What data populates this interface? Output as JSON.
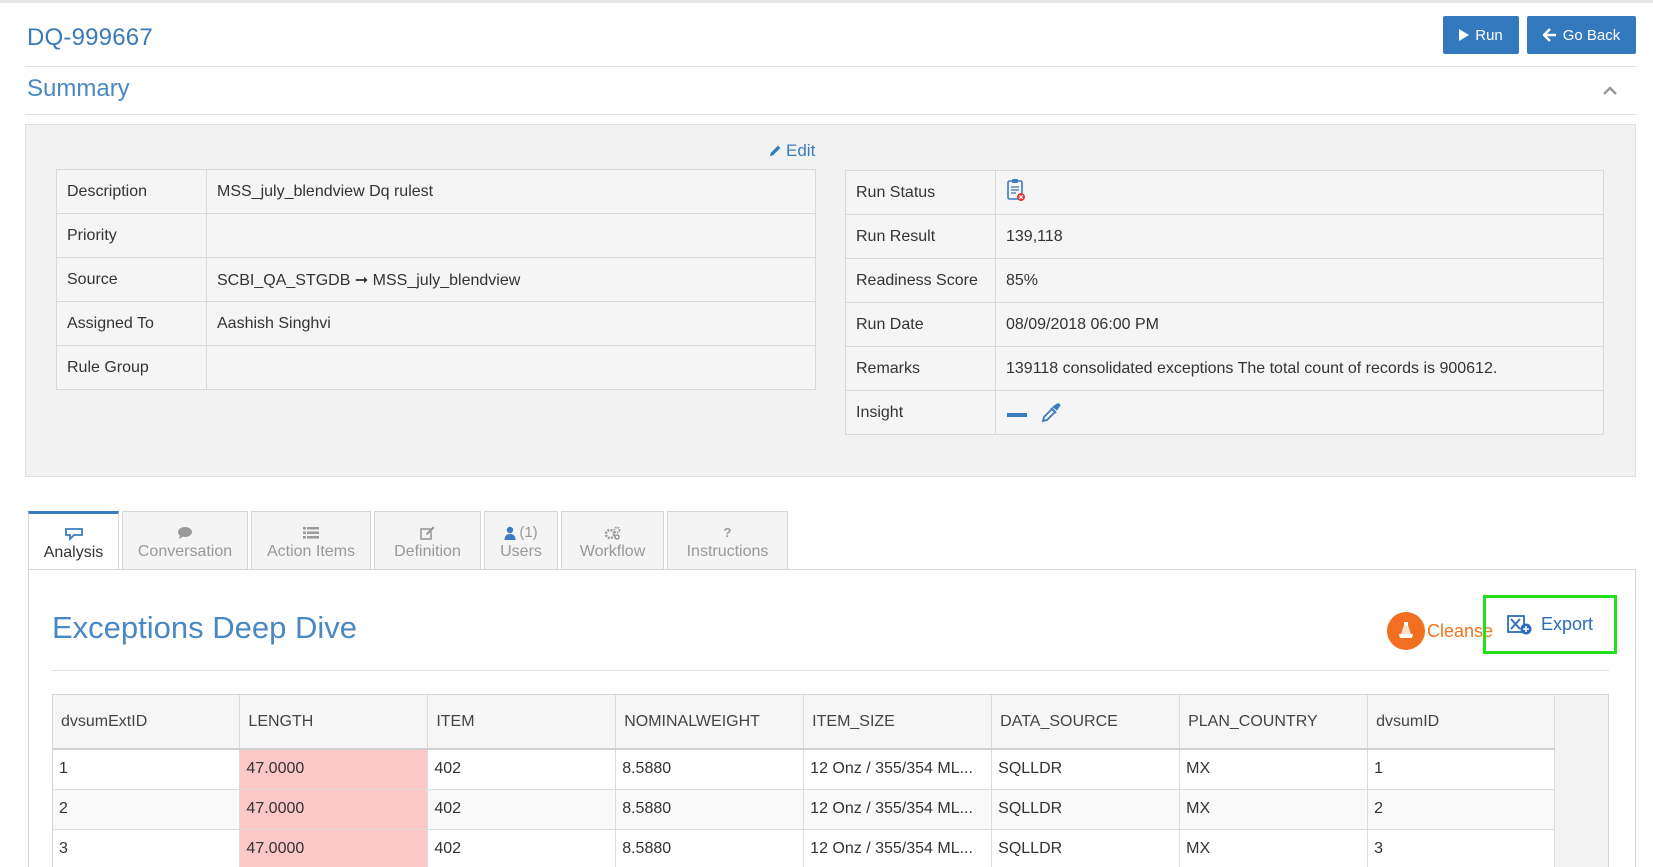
{
  "header": {
    "title": "DQ-999667",
    "run_label": "Run",
    "go_back_label": "Go Back"
  },
  "summary": {
    "title": "Summary",
    "edit_label": "Edit",
    "left_rows": [
      {
        "label": "Description",
        "value": "MSS_july_blendview Dq rulest"
      },
      {
        "label": "Priority",
        "value": ""
      },
      {
        "label": "Source",
        "value": "SCBI_QA_STGDB ➞ MSS_july_blendview"
      },
      {
        "label": "Assigned To",
        "value": "Aashish Singhvi"
      },
      {
        "label": "Rule Group",
        "value": ""
      }
    ],
    "right_rows": [
      {
        "label": "Run Status",
        "value": ""
      },
      {
        "label": "Run Result",
        "value": "139,118"
      },
      {
        "label": "Readiness Score",
        "value": "85%"
      },
      {
        "label": "Run Date",
        "value": "08/09/2018 06:00 PM"
      },
      {
        "label": "Remarks",
        "value": "139118 consolidated exceptions The total count of records is 900612."
      },
      {
        "label": "Insight",
        "value": ""
      }
    ],
    "run_status_icon": "clipboard-error-icon",
    "insight_icons": [
      "minus-icon",
      "eyedropper-icon"
    ]
  },
  "tabs": [
    {
      "label": "Analysis",
      "icon": "analysis-icon",
      "active": true
    },
    {
      "label": "Conversation",
      "icon": "comment-icon"
    },
    {
      "label": "Action Items",
      "icon": "list-icon"
    },
    {
      "label": "Definition",
      "icon": "edit-icon"
    },
    {
      "label": "Users",
      "icon": "user-icon",
      "count": "(1)"
    },
    {
      "label": "Workflow",
      "icon": "cogs-icon"
    },
    {
      "label": "Instructions",
      "icon": "question-icon"
    }
  ],
  "analysis": {
    "title": "Exceptions Deep Dive",
    "cleanse_label": "Cleanse",
    "export_label": "Export"
  },
  "grid": {
    "columns": [
      "dvsumExtID",
      "LENGTH",
      "ITEM",
      "NOMINALWEIGHT",
      "ITEM_SIZE",
      "DATA_SOURCE",
      "PLAN_COUNTRY",
      "dvsumID"
    ],
    "rows": [
      [
        "1",
        "47.0000",
        "402",
        "8.5880",
        "12 Onz / 355/354 ML...",
        "SQLLDR",
        "MX",
        "1"
      ],
      [
        "2",
        "47.0000",
        "402",
        "8.5880",
        "12 Onz / 355/354 ML...",
        "SQLLDR",
        "MX",
        "2"
      ],
      [
        "3",
        "47.0000",
        "402",
        "8.5880",
        "12 Onz / 355/354 ML...",
        "SQLLDR",
        "MX",
        "3"
      ]
    ],
    "highlight_color": "#fbc7c7"
  },
  "colors": {
    "primary": "#3379bd",
    "title_blue": "#4a88c4",
    "cleanse_orange": "#f26f21",
    "export_highlight": "#22e01a"
  }
}
